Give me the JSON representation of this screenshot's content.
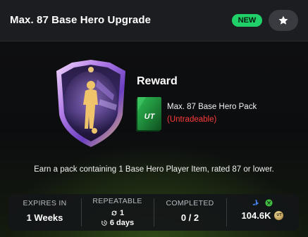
{
  "header": {
    "title": "Max. 87 Base Hero Upgrade",
    "badge": "NEW",
    "favorite_icon": "star-icon"
  },
  "reward": {
    "heading": "Reward",
    "pack_name": "Max. 87 Base Hero Pack",
    "pack_status": "(Untradeable)",
    "pack_logo": "UT"
  },
  "description": "Earn a pack containing 1 Base Hero Player Item, rated 87 or lower.",
  "stats": {
    "expires": {
      "label": "EXPIRES IN",
      "value": "1 Weeks"
    },
    "repeatable": {
      "label": "REPEATABLE",
      "count": "1",
      "timer": "6 days"
    },
    "completed": {
      "label": "COMPLETED",
      "value": "0 / 2"
    },
    "price": {
      "value": "104.6K",
      "coin_label": "UT",
      "platform_icons": [
        "playstation-icon",
        "xbox-icon"
      ]
    }
  },
  "colors": {
    "new_badge": "#20d16a",
    "untradeable": "#ff3b3b",
    "pack_green": "#1f8a3a",
    "badge_purple": "#7b4fd0"
  }
}
